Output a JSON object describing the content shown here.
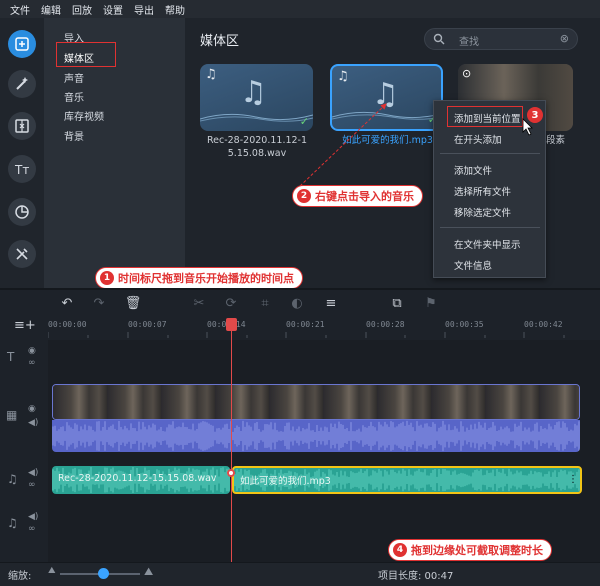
{
  "menubar": [
    "文件",
    "编辑",
    "回放",
    "设置",
    "导出",
    "帮助"
  ],
  "categories": [
    "导入",
    "媒体区",
    "声音",
    "音乐",
    "库存视频",
    "背景"
  ],
  "media": {
    "title": "媒体区",
    "search_placeholder": "查找",
    "items": [
      {
        "caption_line1": "Rec-28-2020.11.12-1",
        "caption_line2": "5.15.08.wav"
      },
      {
        "caption_line1": "如此可爱的我们.mp3"
      },
      {
        "caption_line1": "段素"
      }
    ]
  },
  "context_menu": {
    "add_to_current": "添加到当前位置",
    "add_to_start": "在开头添加",
    "add_file": "添加文件",
    "select_all": "选择所有文件",
    "remove_selected": "移除选定文件",
    "show_in_folder": "在文件夹中显示",
    "file_info": "文件信息"
  },
  "callouts": {
    "c1": "时间标尺拖到音乐开始播放的时间点",
    "c2": "右键点击导入的音乐",
    "c3": "3",
    "c4": "拖到边缘处可截取调整时长",
    "n1": "1",
    "n2": "2",
    "n4": "4"
  },
  "ruler": [
    "00:00:00",
    "00:00:07",
    "00:00:14",
    "00:00:21",
    "00:00:28",
    "00:00:35",
    "00:00:42"
  ],
  "timeline": {
    "audio_clip1": "Rec-28-2020.11.12-15.15.08.wav",
    "audio_clip2": "如此可爱的我们.mp3"
  },
  "footer": {
    "zoom_label": "缩放:",
    "project_length": "项目长度:  00:47"
  },
  "colors": {
    "accent": "#2a8de0",
    "annotation": "#e03232",
    "playhead": "#e24a4a",
    "audio_clip": "#2aa394",
    "video_audio": "#5865c8"
  }
}
